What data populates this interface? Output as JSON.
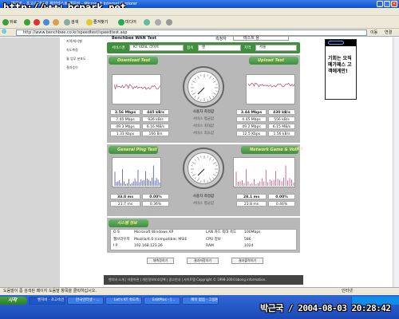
{
  "window": {
    "title": "벤치비 - 초고속인터넷 체험테스트 벤치비 - Microsoft Internet Explorer",
    "watermark": "http://www.bcpark.net"
  },
  "toolbar": {
    "back": "뒤로",
    "search": "검색",
    "favorites": "즐겨찾기",
    "media": "미디어",
    "links": "연결"
  },
  "address": {
    "value": "http://www.benchbee.co.kr/speedtest/speedtest.asp",
    "go": "이동"
  },
  "sidebar": {
    "items": [
      "지역/회사별",
      "속도측정",
      "월 업무 분포도",
      "결과추이"
    ]
  },
  "header": {
    "title": "Benchbee WAN Test",
    "name_label": "측정자",
    "name_value": "테스트 용"
  },
  "service": {
    "label": "서비스명",
    "value": "KT VDSL 라이트",
    "conn_label": "접속",
    "conn_value": "랜",
    "region_label": "지역",
    "region_value": "서울"
  },
  "download": {
    "title": "Download Test",
    "rows": [
      {
        "left": "3.56 Mbps",
        "mid": "445 kB/s",
        "label": "사용자 측정값",
        "right": "3.44 Mbps",
        "right2": "430 kB/s"
      },
      {
        "left": "7.40 Mbps",
        "mid": "926 kB/s",
        "label": "서비스 평균값",
        "right": "4.45 Mbps",
        "right2": "556 kB/s"
      },
      {
        "left": "49.3 Mbps",
        "mid": "6.16 MB/s",
        "label": "서비스 최대값",
        "right": "49.2 Mbps",
        "right2": "6.15 MB/s"
      },
      {
        "left": "1.33 Kbps",
        "mid": "166 B/s",
        "label": "서비스 최소값",
        "right": "12.5 Kbps",
        "right2": "1.56 kB/s"
      }
    ]
  },
  "upload": {
    "title": "Upload Test"
  },
  "ping": {
    "title": "General Ping Test",
    "rows": [
      {
        "left": "33.8 ms",
        "mid": "0.00%",
        "label": "사용자 측정값",
        "right": "28.1 ms",
        "right2": "0.00%"
      },
      {
        "left": "21.7 ms",
        "mid": "0.36%",
        "label": "서비스 평균값",
        "right": "23.8 ms",
        "right2": "0.46%"
      }
    ]
  },
  "game": {
    "title": "Network Game & VoIP Test"
  },
  "sysinfo": {
    "title": "시스템 정보",
    "rows": [
      {
        "k": "O S",
        "v": "Microsoft Windows XP",
        "k2": "LAN 카드 최대 속도",
        "v2": "100Mbps"
      },
      {
        "k": "웹브라우저",
        "v": "Mozilla/4.0 (compatible; MSIE",
        "k2": "CPU 정보",
        "v2": "586"
      },
      {
        "k": "I P",
        "v": "192.168.123.26",
        "k2": "RAM",
        "v2": "1024"
      }
    ]
  },
  "buttons": {
    "retest": "재측정하기",
    "save": "결과저장하기",
    "print": "결과출력하기"
  },
  "footer": {
    "text": "벤치비 소개 | 이용약관 | 개인정보보호정책 | 광고안내 | 사이트맵    Copyright © 1998-2004 bbong information."
  },
  "ad": {
    "text": "기회는 오직 메가패스 고객에게만!"
  },
  "statusbar": {
    "left": "도움말이 좀 검색된 페이지 도움말 항목을 클릭하십시오.",
    "right": "인터넷"
  },
  "taskbar": {
    "start": "시작",
    "tasks": [
      "벤치비 - 초고속인...",
      "한국인터넷 - ...",
      "Let's KT 속도측...",
      "EditPlus - [...",
      "제목 없음 - 그림판"
    ],
    "caption": "박근국 / 2004-08-03 20:28:42"
  },
  "colors": {
    "section_green": "#4a9a4a",
    "section_blue": "#2d5d96",
    "title_text": "#ffe98a"
  }
}
